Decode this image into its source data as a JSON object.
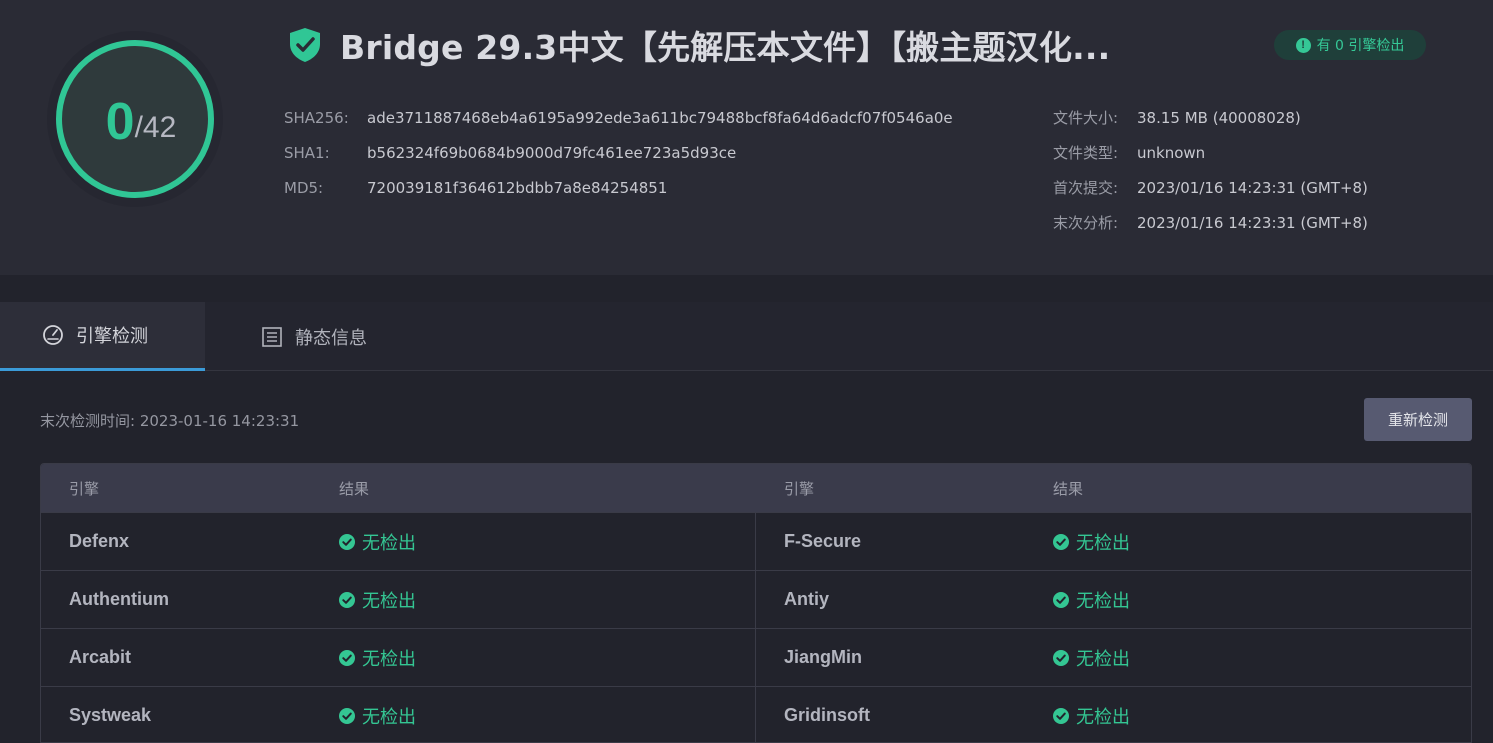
{
  "summary": {
    "score": "0",
    "score_total": "/42",
    "title": "Bridge 29.3中文【先解压本文件】【搬主题汉化...",
    "detect_badge": "有 0 引擎检出",
    "hashes": [
      {
        "key": "SHA256:",
        "value": "ade3711887468eb4a6195a992ede3a611bc79488bcf8fa64d6adcf07f0546a0e"
      },
      {
        "key": "SHA1:",
        "value": "b562324f69b0684b9000d79fc461ee723a5d93ce"
      },
      {
        "key": "MD5:",
        "value": "720039181f364612bdbb7a8e84254851"
      }
    ],
    "meta": [
      {
        "key": "文件大小:",
        "value": "38.15 MB (40008028)"
      },
      {
        "key": "文件类型:",
        "value": "unknown"
      },
      {
        "key": "首次提交:",
        "value": "2023/01/16 14:23:31 (GMT+8)"
      },
      {
        "key": "末次分析:",
        "value": "2023/01/16 14:23:31 (GMT+8)"
      }
    ],
    "colors": {
      "accent": "#30c695",
      "ring_bg": "#2f3a3c"
    }
  },
  "tabs": [
    {
      "label": "引擎检测",
      "icon": "gauge-icon",
      "active": true
    },
    {
      "label": "静态信息",
      "icon": "list-icon",
      "active": false
    }
  ],
  "toolbar": {
    "last_check": "末次检测时间: 2023-01-16 14:23:31",
    "rescan_label": "重新检测"
  },
  "table": {
    "headers": [
      "引擎",
      "结果",
      "引擎",
      "结果"
    ],
    "rows": [
      {
        "left_engine": "Defenx",
        "left_result": "无检出",
        "right_engine": "F-Secure",
        "right_result": "无检出"
      },
      {
        "left_engine": "Authentium",
        "left_result": "无检出",
        "right_engine": "Antiy",
        "right_result": "无检出"
      },
      {
        "left_engine": "Arcabit",
        "left_result": "无检出",
        "right_engine": "JiangMin",
        "right_result": "无检出"
      },
      {
        "left_engine": "Systweak",
        "left_result": "无检出",
        "right_engine": "Gridinsoft",
        "right_result": "无检出"
      }
    ]
  }
}
